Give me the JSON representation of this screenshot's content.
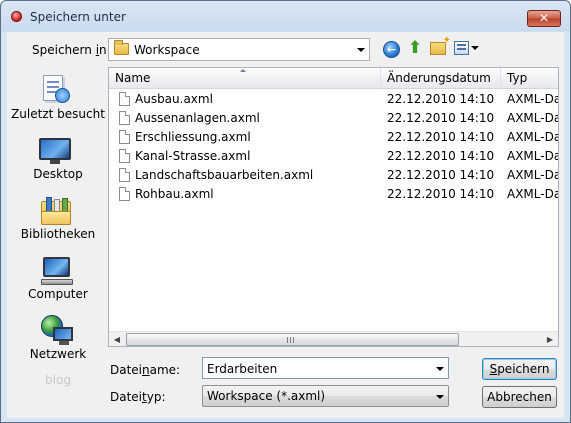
{
  "window": {
    "title": "Speichern unter",
    "close_label": "✕"
  },
  "toolbar": {
    "save_in_label_pre": "Speichern ",
    "save_in_label_accel": "i",
    "save_in_label_post": "n:",
    "location": "Workspace"
  },
  "places": [
    {
      "label": "Zuletzt besucht",
      "icon": "recent-places-icon"
    },
    {
      "label": "Desktop",
      "icon": "desktop-icon"
    },
    {
      "label": "Bibliotheken",
      "icon": "libraries-icon"
    },
    {
      "label": "Computer",
      "icon": "computer-icon"
    },
    {
      "label": "Netzwerk",
      "icon": "network-icon"
    }
  ],
  "watermark": "blog",
  "columns": {
    "name": "Name",
    "date": "Änderungsdatum",
    "type": "Typ"
  },
  "files": [
    {
      "name": "Ausbau.axml",
      "date": "22.12.2010 14:10",
      "type": "AXML-Dat"
    },
    {
      "name": "Aussenanlagen.axml",
      "date": "22.12.2010 14:10",
      "type": "AXML-Dat"
    },
    {
      "name": "Erschliessung.axml",
      "date": "22.12.2010 14:10",
      "type": "AXML-Dat"
    },
    {
      "name": "Kanal-Strasse.axml",
      "date": "22.12.2010 14:10",
      "type": "AXML-Dat"
    },
    {
      "name": "Landschaftsbauarbeiten.axml",
      "date": "22.12.2010 14:10",
      "type": "AXML-Dat"
    },
    {
      "name": "Rohbau.axml",
      "date": "22.12.2010 14:10",
      "type": "AXML-Dat"
    }
  ],
  "form": {
    "filename_label_pre": "Datei",
    "filename_label_accel": "n",
    "filename_label_post": "ame:",
    "filename_value": "Erdarbeiten",
    "filetype_label_pre": "Datei",
    "filetype_label_accel": "t",
    "filetype_label_post": "yp:",
    "filetype_value": "Workspace (*.axml)"
  },
  "buttons": {
    "save_accel": "S",
    "save_rest": "peichern",
    "cancel": "Abbrechen"
  },
  "colors": {
    "titlebar": "#cbdcef",
    "close": "#c95d47",
    "default_button_border": "#3c7fb1"
  }
}
